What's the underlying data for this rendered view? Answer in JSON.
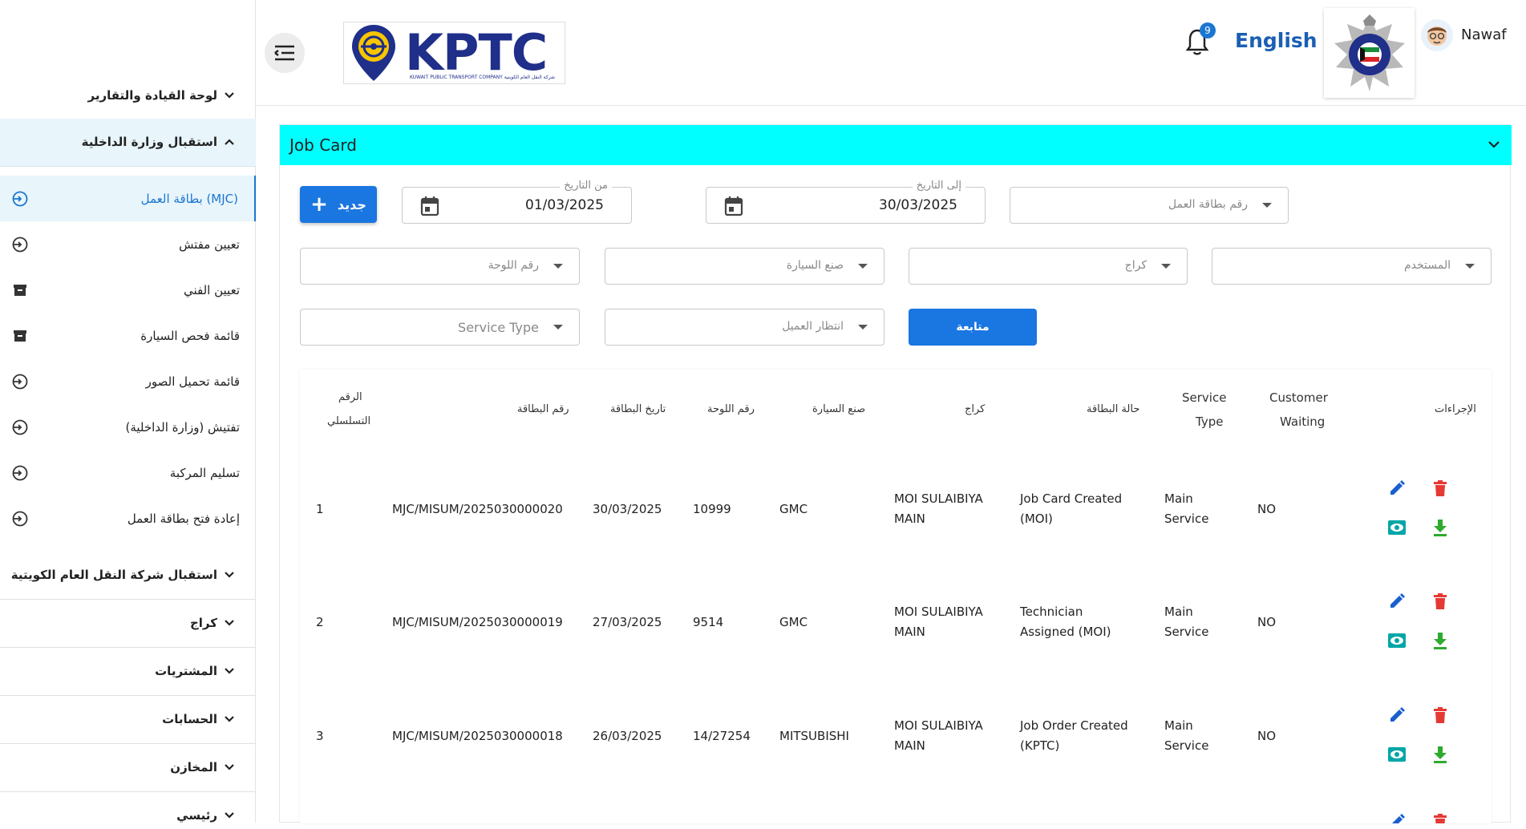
{
  "sidebar": {
    "groups_top": [
      {
        "label": "لوحة القيادة والتقارير"
      },
      {
        "label": "استقبال وزارة الداخلية"
      }
    ],
    "items": [
      {
        "label": "بطاقة العمل (MJC)",
        "icon": "login-icon"
      },
      {
        "label": "تعيين مفتش",
        "icon": "login-icon"
      },
      {
        "label": "تعيين الفني",
        "icon": "archive-icon"
      },
      {
        "label": "قائمة فحص السيارة",
        "icon": "archive-icon"
      },
      {
        "label": "قائمة تحميل الصور",
        "icon": "login-icon"
      },
      {
        "label": "تفتيش (وزارة الداخلية)",
        "icon": "login-icon"
      },
      {
        "label": "تسليم المركبة",
        "icon": "login-icon"
      },
      {
        "label": "إعادة فتح بطاقة العمل",
        "icon": "login-icon"
      }
    ],
    "groups_bottom": [
      {
        "label": "استقبال شركة النقل العام الكويتية"
      },
      {
        "label": "كراج"
      },
      {
        "label": "المشتريات"
      },
      {
        "label": "الحسابات"
      },
      {
        "label": "المخازن"
      },
      {
        "label": "رئيسي"
      }
    ]
  },
  "header": {
    "logo_text": "KPTC",
    "logo_subtext": "KUWAIT PUBLIC TRANSPORT COMPANY  شركة النقل العام الكويتية",
    "notification_count": "9",
    "language": "English",
    "user_name": "Nawaf"
  },
  "card": {
    "title": "Job Card",
    "new_button": "جديد",
    "from_date_label": "من التاريخ",
    "from_date": "01/03/2025",
    "to_date_label": "إلى التاريخ",
    "to_date": "30/03/2025",
    "job_card_no_placeholder": "رقم بطاقة العمل",
    "plate_no_placeholder": "رقم اللوحة",
    "car_make_placeholder": "صنع السيارة",
    "garage_placeholder": "كراج",
    "user_placeholder": "المستخدم",
    "service_type_placeholder": "Service Type",
    "customer_waiting_placeholder": "انتظار العميل",
    "continue_button": "متابعة"
  },
  "table": {
    "headers": {
      "serial_line1": "الرقم",
      "serial_line2": "التسلسلي",
      "card_no": "رقم البطاقة",
      "card_date": "تاريخ البطاقة",
      "plate_no": "رقم اللوحة",
      "car_make": "صنع السيارة",
      "garage": "كراج",
      "card_status": "حالة البطاقة",
      "service_type_line1": "Service",
      "service_type_line2": "Type",
      "customer_waiting_line1": "Customer",
      "customer_waiting_line2": "Waiting",
      "actions": "الإجراءات"
    },
    "rows": [
      {
        "serial": "1",
        "card_no": "MJC/MISUM/2025030000020",
        "date": "30/03/2025",
        "plate": "10999",
        "make": "GMC",
        "garage_l1": "MOI SULAIBIYA",
        "garage_l2": "MAIN",
        "status_l1": "Job Card Created",
        "status_l2": "(MOI)",
        "service_l1": "Main",
        "service_l2": "Service",
        "waiting": "NO"
      },
      {
        "serial": "2",
        "card_no": "MJC/MISUM/2025030000019",
        "date": "27/03/2025",
        "plate": "9514",
        "make": "GMC",
        "garage_l1": "MOI SULAIBIYA",
        "garage_l2": "MAIN",
        "status_l1": "Technician",
        "status_l2": "Assigned (MOI)",
        "service_l1": "Main",
        "service_l2": "Service",
        "waiting": "NO"
      },
      {
        "serial": "3",
        "card_no": "MJC/MISUM/2025030000018",
        "date": "26/03/2025",
        "plate": "14/27254",
        "make": "MITSUBISHI",
        "garage_l1": "MOI SULAIBIYA",
        "garage_l2": "MAIN",
        "status_l1": "Job Order Created",
        "status_l2": "(KPTC)",
        "service_l1": "Main",
        "service_l2": "Service",
        "waiting": "NO"
      }
    ]
  },
  "colors": {
    "accent": "#1a76e0",
    "card_header": "#00ffff",
    "edit": "#1a5fd0",
    "delete": "#e53935",
    "view": "#00a6a6",
    "download": "#2eaa2e"
  }
}
